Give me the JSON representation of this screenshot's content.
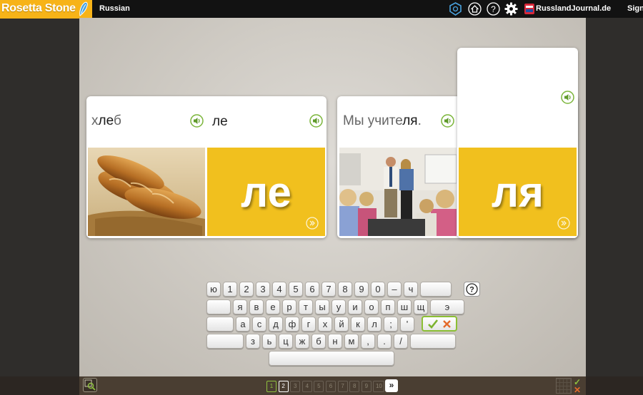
{
  "app": {
    "brand": "Rosetta Stone",
    "language": "Russian",
    "site_label": "RusslandJournal.de",
    "signin": "Sign"
  },
  "topbar_icons": [
    "badge-icon",
    "home-icon",
    "help-icon",
    "settings-icon"
  ],
  "cards": [
    {
      "word_pre": "х",
      "word_hl": "ле",
      "word_post": "б",
      "syllable_header": "ле",
      "syllable_big": "ле",
      "image": "bread loaf in basket"
    },
    {
      "word_pre": "Мы учите",
      "word_hl": "ля",
      "word_post": ".",
      "syllable_header": "",
      "syllable_big": "ля",
      "image": "two teachers in classroom"
    }
  ],
  "keyboard": {
    "row1": [
      "ю",
      "1",
      "2",
      "3",
      "4",
      "5",
      "6",
      "7",
      "8",
      "9",
      "0",
      "–",
      "ч",
      ""
    ],
    "row2": [
      "",
      "я",
      "в",
      "е",
      "р",
      "т",
      "ы",
      "у",
      "и",
      "о",
      "п",
      "ш",
      "щ",
      "э"
    ],
    "row3": [
      "",
      "а",
      "с",
      "д",
      "ф",
      "г",
      "х",
      "й",
      "к",
      "л",
      ";",
      "'"
    ],
    "row4": [
      "",
      "з",
      "ь",
      "ц",
      "ж",
      "б",
      "н",
      "м",
      ",",
      ".",
      "/",
      ""
    ],
    "help": "?"
  },
  "pager": {
    "pages": [
      "1",
      "2",
      "3",
      "4",
      "5",
      "6",
      "7",
      "8",
      "9",
      "10"
    ],
    "completed": 1,
    "current": 2,
    "next_label": "»"
  },
  "colors": {
    "brand_yellow": "#f7b318",
    "card_yellow": "#f1c01e",
    "accent_green": "#8fc13e",
    "accent_orange": "#e46a2a"
  }
}
